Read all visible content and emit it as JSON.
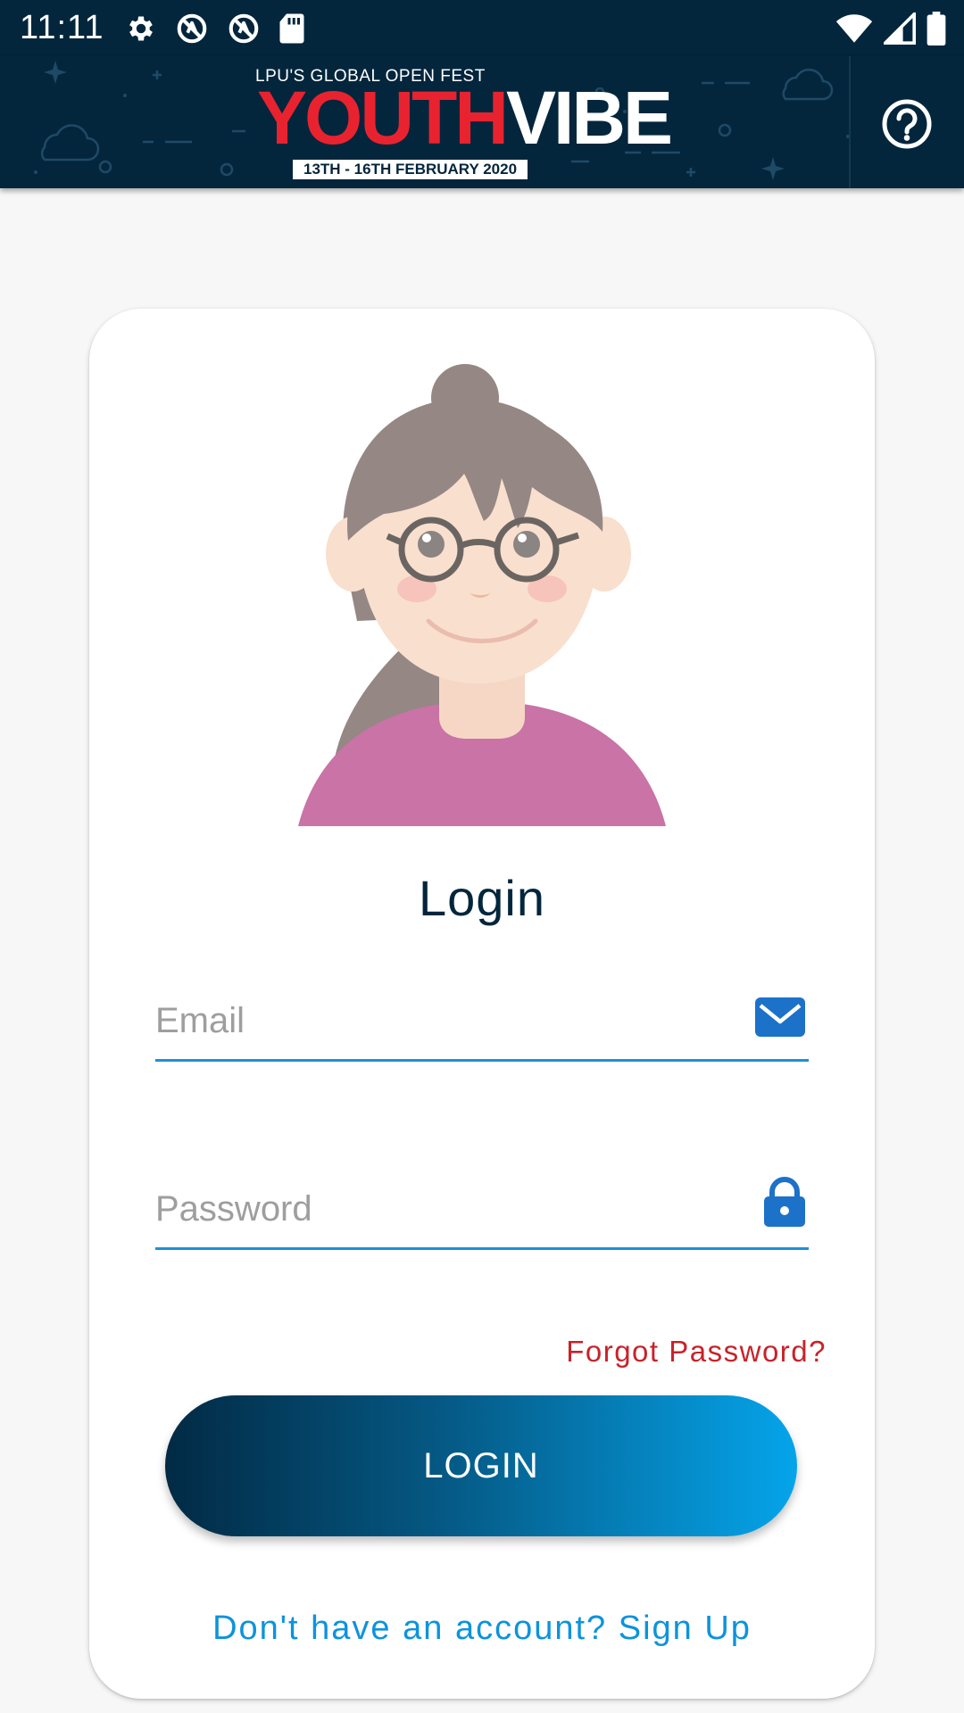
{
  "status_bar": {
    "time": "11:11",
    "left_icons": [
      "gear-icon",
      "sync-off-icon",
      "sync-off-icon",
      "sd-card-icon"
    ],
    "right_icons": [
      "wifi-icon",
      "signal-icon",
      "battery-icon"
    ]
  },
  "header": {
    "tagline": "LPU'S GLOBAL OPEN FEST",
    "title_part1": "YOUTH",
    "title_part2": "VIBE",
    "dates": "13TH - 16TH FEBRUARY 2020",
    "background_color": "#03263d",
    "accent_red": "#e8232f"
  },
  "login_card": {
    "title": "Login",
    "email": {
      "value": "",
      "placeholder": "Email",
      "icon": "mail-icon"
    },
    "password": {
      "value": "",
      "placeholder": "Password",
      "icon": "lock-icon"
    },
    "forgot_password_label": "Forgot Password?",
    "login_button_label": "LOGIN",
    "signup_prompt": "Don't have an account? Sign Up"
  },
  "colors": {
    "link_blue": "#0d93dc",
    "link_red": "#c7232a",
    "field_underline": "#1e90d6"
  }
}
